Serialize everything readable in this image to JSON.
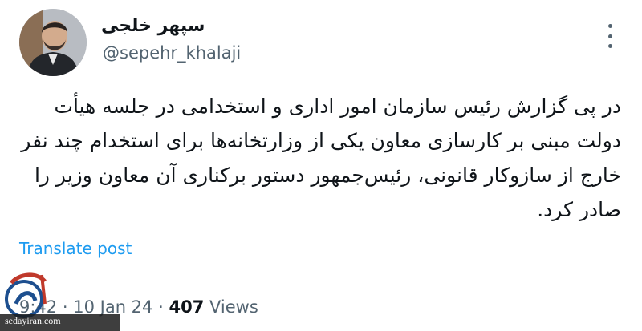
{
  "author": {
    "display_name": "سپهر خلجی",
    "handle": "@sepehr_khalaji"
  },
  "icons": {
    "more": "more-vertical-icon",
    "avatar": "profile-photo",
    "watermark": "site-logo"
  },
  "tweet": {
    "lines": [
      "در پی گزارش رئیس سازمان امور اداری و استخدامی در جلسه هیأت",
      "دولت مبنی بر کارسازی معاون یکی از وزارتخانه‌ها برای استخدام چند نفر",
      "خارج از سازوکار قانونی، رئیس‌جمهور دستور برکناری آن معاون وزیر را",
      "صادر کرد."
    ]
  },
  "translate_label": "Translate post",
  "meta": {
    "time": "9:42",
    "separator": "·",
    "date": "10 Jan 24",
    "views_count": "407",
    "views_label": "Views"
  },
  "watermark": {
    "text": "sedayiran.com"
  },
  "colors": {
    "text": "#0f1419",
    "secondary": "#536471",
    "link": "#1d9bf0"
  }
}
